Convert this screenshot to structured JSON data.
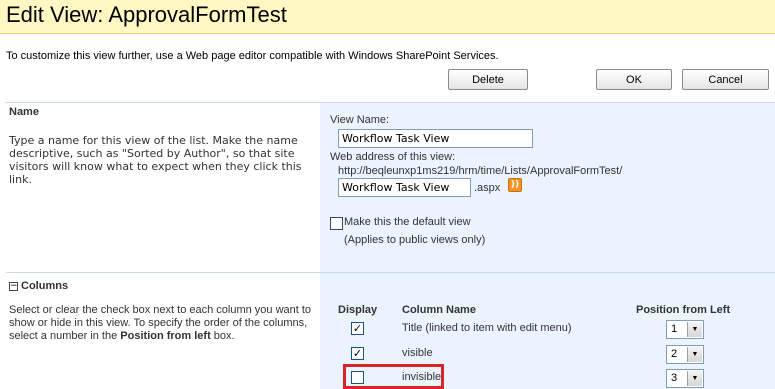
{
  "page": {
    "title": "Edit View: ApprovalFormTest",
    "intro": "To customize this view further, use a Web page editor compatible with Windows SharePoint Services."
  },
  "toolbar": {
    "delete_label": "Delete",
    "ok_label": "OK",
    "cancel_label": "Cancel"
  },
  "name_section": {
    "title": "Name",
    "description": "Type a name for this view of the list. Make the name descriptive, such as \"Sorted by Author\", so that site visitors will know what to expect when they click this link.",
    "view_name_label": "View Name:",
    "view_name_value": "Workflow Task View",
    "web_address_label": "Web address of this view:",
    "web_address_url": "http://beqleunxp1ms219/hrm/time/Lists/ApprovalFormTest/",
    "web_address_value": "Workflow Task View",
    "extension": ".aspx",
    "default_view_label": "Make this the default view",
    "default_view_note": "(Applies to public views only)",
    "default_view_checked": false
  },
  "columns_section": {
    "collapse_glyph": "−",
    "title": "Columns",
    "description_part1": "Select or clear the check box next to each column you want to show or hide in this view. To specify the order of the columns, select a number in the ",
    "description_bold": "Position from left",
    "description_part2": " box.",
    "headers": {
      "display": "Display",
      "column_name": "Column Name",
      "position": "Position from Left"
    },
    "rows": [
      {
        "display": true,
        "name": "Title (linked to item with edit menu)",
        "position": "1"
      },
      {
        "display": true,
        "name": "visible",
        "position": "2"
      },
      {
        "display": false,
        "name": "invisible",
        "position": "3"
      }
    ]
  },
  "colors": {
    "title_bar": "#fff7c3",
    "panel": "#ebf3ff",
    "highlight": "#d9252a"
  }
}
